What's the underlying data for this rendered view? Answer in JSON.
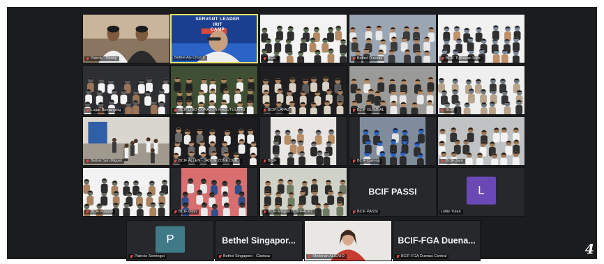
{
  "page_number": "4",
  "colors": {
    "meeting_bg": "#1b1c1e",
    "tile_bg": "#26282b",
    "active_speaker_border": "#e9e36a",
    "muted_icon": "#e04a4a",
    "avatar_purple": "#6a48b5",
    "avatar_teal": "#3f7a86"
  },
  "grid": [
    [
      {
        "type": "video",
        "scene": "two-men",
        "name": "Patrick · Donny",
        "muted": true,
        "palette": [
          "#c9b59a",
          "#7c5a3c",
          "#2a2a2a",
          "#f0f0f0"
        ]
      },
      {
        "type": "video",
        "scene": "speaker-banner",
        "name": "Bethel AG Church",
        "muted": false,
        "speaking": true,
        "banner_line1": "SERVANT LEADER",
        "banner_line2": "IRIT",
        "banner_line3": "CAMP",
        "palette": [
          "#2b63c7",
          "#1a3f8f",
          "#d84a3a",
          "#eeeeee"
        ]
      },
      {
        "type": "video",
        "scene": "crowd",
        "name": "BCIF",
        "muted": true,
        "palette": [
          "#f3f3f3",
          "#2e2e2e",
          "#b38a64",
          "#5f6f55"
        ]
      },
      {
        "type": "video",
        "scene": "crowd",
        "name": "Bethel Duenas",
        "muted": true,
        "palette": [
          "#9aa6b4",
          "#e8e8e8",
          "#3a3a3a",
          "#b08868"
        ]
      },
      {
        "type": "video",
        "scene": "crowd",
        "name": "BCIF Tigbauan Iloilo",
        "muted": true,
        "palette": [
          "#f1f1f1",
          "#2f2f2f",
          "#c0916a",
          "#7d8a9a"
        ]
      }
    ],
    [
      {
        "type": "video",
        "scene": "crowd",
        "name": "Lugar Bumanglag",
        "muted": true,
        "palette": [
          "#2e2f33",
          "#f3f3f3",
          "#9b7458",
          "#5c5c5c"
        ]
      },
      {
        "type": "video",
        "scene": "crowd",
        "name": "BCIF LIBO CORAZON MABUTULANG",
        "muted": true,
        "palette": [
          "#3e4f33",
          "#f0f0f0",
          "#222222",
          "#a7845f"
        ]
      },
      {
        "type": "video",
        "scene": "crowd",
        "name": "BCIF LAPAZ",
        "muted": true,
        "palette": [
          "#1f1f21",
          "#d9d2c4",
          "#5a5a5a",
          "#a87e5c"
        ]
      },
      {
        "type": "video",
        "scene": "crowd",
        "name": "BCIF GUIMBAL",
        "muted": true,
        "palette": [
          "#9a9a98",
          "#2d2d2d",
          "#e9e9e9",
          "#b58a63"
        ]
      },
      {
        "type": "video",
        "scene": "crowd",
        "name": "BCIF",
        "muted": true,
        "palette": [
          "#efefef",
          "#b8a48a",
          "#353535",
          "#6f7a82"
        ]
      }
    ],
    [
      {
        "type": "video",
        "scene": "room",
        "name": "Bethel San Miguel",
        "muted": true,
        "palette": [
          "#d9d6cf",
          "#2f5fa7",
          "#7f7a70",
          "#3a3a3a"
        ]
      },
      {
        "type": "video",
        "scene": "crowd",
        "name": "BCIF ALLEN - JABON ZONE DUB...",
        "muted": true,
        "palette": [
          "#1d1d1f",
          "#ececec",
          "#6a6a6a",
          "#b38b6a"
        ]
      },
      {
        "type": "video",
        "scene": "crowd-small",
        "name": "BCIF",
        "muted": true,
        "palette": [
          "#e8e6e2",
          "#2b2b2b",
          "#b78d66",
          "#7a7a7a"
        ]
      },
      {
        "type": "video",
        "scene": "crowd-small",
        "name": "BCIF Calinog",
        "muted": true,
        "palette": [
          "#7f8c9b",
          "#2d2d2d",
          "#e3e3e3",
          "#2c63c0"
        ]
      },
      {
        "type": "video",
        "scene": "crowd",
        "name": "BCIF Jaro",
        "muted": true,
        "palette": [
          "#bfc3c4",
          "#f2f2f2",
          "#323232",
          "#a07a5a"
        ]
      }
    ],
    [
      {
        "type": "video",
        "scene": "crowd",
        "name": "BCIF Miagao",
        "muted": true,
        "palette": [
          "#f2f2f2",
          "#2e2e2e",
          "#a9825f",
          "#6a6e62"
        ]
      },
      {
        "type": "video",
        "scene": "crowd-small",
        "name": "BCIF Oton",
        "muted": true,
        "palette": [
          "#d96e6e",
          "#e9e9e9",
          "#2f4f8a",
          "#3a3a3a"
        ]
      },
      {
        "type": "video",
        "scene": "crowd",
        "name": "BCIF Miagao BONIFACIO",
        "muted": true,
        "palette": [
          "#cfd2c8",
          "#2c2c2c",
          "#6f7a62",
          "#a58060"
        ]
      },
      {
        "type": "text",
        "label": "BCIF PASSI",
        "name": "BCIF PASSI",
        "muted": true
      },
      {
        "type": "avatar",
        "initial": "L",
        "avatar_color": "purple",
        "name": "Lottie Yulan",
        "muted": false
      }
    ]
  ],
  "bottom_row": [
    {
      "type": "avatar",
      "initial": "P",
      "avatar_color": "teal",
      "name": "Patricio Somingui",
      "muted": true
    },
    {
      "type": "text",
      "label": "Bethel Singapor...",
      "name": "Bethel Singapore - Clarissa",
      "muted": true
    },
    {
      "type": "video",
      "scene": "single-woman",
      "name": "Shekinah ALIENIO",
      "muted": true,
      "palette": [
        "#e9e7e4",
        "#c43d2f",
        "#3a2a22",
        "#d8a98a"
      ]
    },
    {
      "type": "text",
      "label": "BCIF-FGA Duena...",
      "name": "BCIF-FGA Duenas Central",
      "muted": true
    }
  ]
}
